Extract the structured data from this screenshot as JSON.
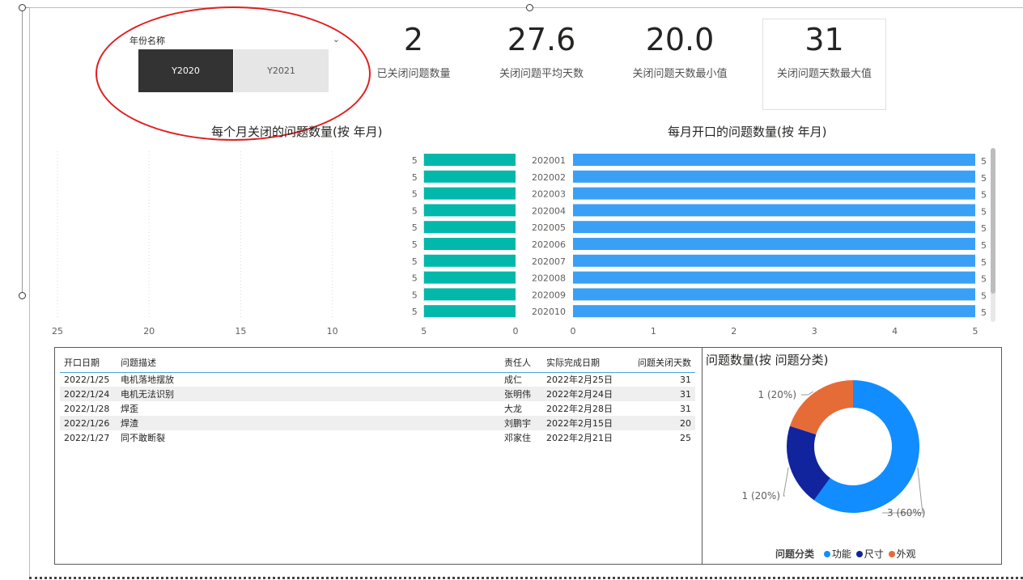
{
  "slicer": {
    "title": "年份名称",
    "options": [
      "Y2020",
      "Y2021"
    ],
    "selected": "Y2020"
  },
  "kpis": [
    {
      "value": "2",
      "label": "已关闭问题数量"
    },
    {
      "value": "27.6",
      "label": "关闭问题平均天数"
    },
    {
      "value": "20.0",
      "label": "关闭问题天数最小值"
    },
    {
      "value": "31",
      "label": "关闭问题天数最大值"
    }
  ],
  "charts": {
    "closed_title": "每个月关闭的问题数量(按 年月)",
    "opened_title": "每月开口的问题数量(按 年月)",
    "pie_title": "问题数量(按 问题分类)"
  },
  "colors": {
    "closed_bar": "#01b8aa",
    "opened_bar": "#3aa0f5",
    "pie_func": "#118dff",
    "pie_size": "#12239e",
    "pie_look": "#e66c37"
  },
  "chart_data": [
    {
      "type": "bar",
      "orientation": "horizontal",
      "title": "每个月关闭的问题数量(按 年月)",
      "categories": [
        "202001",
        "202002",
        "202003",
        "202004",
        "202005",
        "202006",
        "202007",
        "202008",
        "202009",
        "202010"
      ],
      "values": [
        5,
        5,
        5,
        5,
        5,
        5,
        5,
        5,
        5,
        5
      ],
      "xlim": [
        25,
        0
      ],
      "xticks": [
        "25",
        "20",
        "15",
        "10",
        "5",
        "0"
      ],
      "data_labels": [
        "5",
        "5",
        "5",
        "5",
        "5",
        "5",
        "5",
        "5",
        "5",
        "5"
      ]
    },
    {
      "type": "bar",
      "orientation": "horizontal",
      "title": "每月开口的问题数量(按 年月)",
      "categories": [
        "202001",
        "202002",
        "202003",
        "202004",
        "202005",
        "202006",
        "202007",
        "202008",
        "202009",
        "202010"
      ],
      "values": [
        5,
        5,
        5,
        5,
        5,
        5,
        5,
        5,
        5,
        5
      ],
      "xlim": [
        0,
        5
      ],
      "xticks": [
        "0",
        "1",
        "2",
        "3",
        "4",
        "5"
      ],
      "data_labels": [
        "5",
        "5",
        "5",
        "5",
        "5",
        "5",
        "5",
        "5",
        "5",
        "5"
      ]
    },
    {
      "type": "pie",
      "title": "问题数量(按 问题分类)",
      "legend_title": "问题分类",
      "slices": [
        {
          "name": "功能",
          "value": 3,
          "label": "3 (60%)"
        },
        {
          "name": "尺寸",
          "value": 1,
          "label": "1 (20%)"
        },
        {
          "name": "外观",
          "value": 1,
          "label": "1 (20%)"
        }
      ]
    }
  ],
  "table": {
    "columns": [
      "开口日期",
      "问题描述",
      "责任人",
      "实际完成日期",
      "问题关闭天数"
    ],
    "rows": [
      [
        "2022/1/25",
        "电机落地摆放",
        "成仁",
        "2022年2月25日",
        "31"
      ],
      [
        "2022/1/24",
        "电机无法识别",
        "张明伟",
        "2022年2月24日",
        "31"
      ],
      [
        "2022/1/28",
        "焊歪",
        "大龙",
        "2022年2月28日",
        "31"
      ],
      [
        "2022/1/26",
        "焊渣",
        "刘鹏宇",
        "2022年2月15日",
        "20"
      ],
      [
        "2022/1/27",
        "同不敢断裂",
        "邓家住",
        "2022年2月21日",
        "25"
      ]
    ]
  }
}
